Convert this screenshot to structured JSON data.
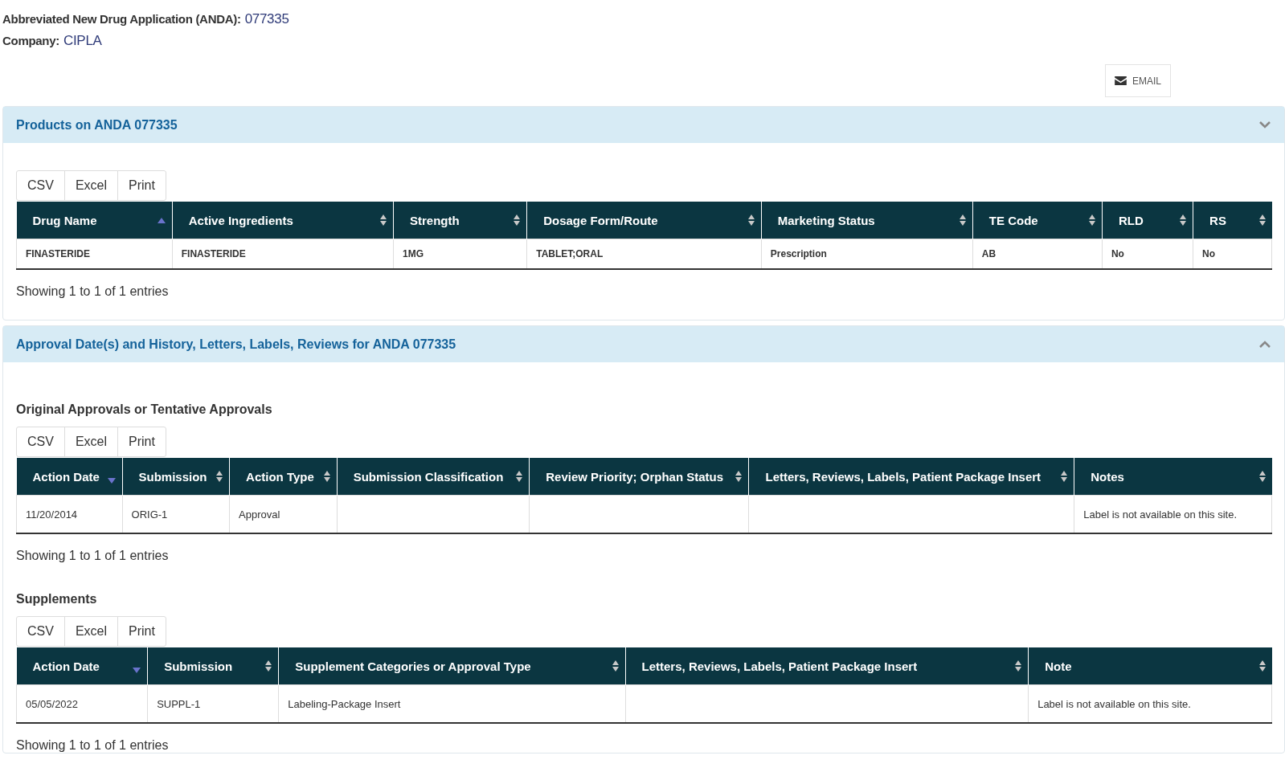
{
  "application": {
    "label": "Abbreviated New Drug Application (ANDA):",
    "value": "077335"
  },
  "company": {
    "label": "Company:",
    "value": "CIPLA"
  },
  "email_button": {
    "label": "EMAIL"
  },
  "panels": [
    {
      "title": "Products on ANDA 077335",
      "chevron_up": false,
      "sections": [
        {
          "buttons": [
            "CSV",
            "Excel",
            "Print"
          ],
          "bold_cells": true,
          "info": "Showing 1 to 1 of 1 entries",
          "columns": [
            {
              "label": "Drug Name",
              "sorted": true,
              "descending": false
            },
            {
              "label": "Active Ingredients",
              "sorted": false,
              "descending": false
            },
            {
              "label": "Strength",
              "sorted": false,
              "descending": false
            },
            {
              "label": "Dosage Form/Route",
              "sorted": false,
              "descending": false
            },
            {
              "label": "Marketing Status",
              "sorted": false,
              "descending": false
            },
            {
              "label": "TE Code",
              "sorted": false,
              "descending": false
            },
            {
              "label": "RLD",
              "sorted": false,
              "descending": false
            },
            {
              "label": "RS",
              "sorted": false,
              "descending": false
            }
          ],
          "rows": [
            [
              "FINASTERIDE",
              "FINASTERIDE",
              "1MG",
              "TABLET;ORAL",
              "Prescription",
              "AB",
              "No",
              "No"
            ]
          ]
        }
      ]
    },
    {
      "title": "Approval Date(s) and History, Letters, Labels, Reviews for ANDA 077335",
      "chevron_up": true,
      "sections": [
        {
          "heading": "Original Approvals or Tentative Approvals",
          "buttons": [
            "CSV",
            "Excel",
            "Print"
          ],
          "bold_cells": false,
          "info": "Showing 1 to 1 of 1 entries",
          "columns": [
            {
              "label": "Action Date",
              "sorted": true,
              "descending": true
            },
            {
              "label": "Submission",
              "sorted": false,
              "descending": false
            },
            {
              "label": "Action Type",
              "sorted": false,
              "descending": false
            },
            {
              "label": "Submission Classification",
              "sorted": false,
              "descending": false
            },
            {
              "label": "Review Priority; Orphan Status",
              "sorted": false,
              "descending": false
            },
            {
              "label": "Letters, Reviews, Labels, Patient Package Insert",
              "sorted": false,
              "descending": false
            },
            {
              "label": "Notes",
              "sorted": false,
              "descending": false
            }
          ],
          "rows": [
            [
              "11/20/2014",
              "ORIG-1",
              "Approval",
              "",
              "",
              "",
              "Label is not available on this site."
            ]
          ]
        },
        {
          "heading": "Supplements",
          "buttons": [
            "CSV",
            "Excel",
            "Print"
          ],
          "bold_cells": false,
          "info": "Showing 1 to 1 of 1 entries",
          "columns": [
            {
              "label": "Action Date",
              "sorted": true,
              "descending": true
            },
            {
              "label": "Submission",
              "sorted": false,
              "descending": false
            },
            {
              "label": "Supplement Categories or Approval Type",
              "sorted": false,
              "descending": false
            },
            {
              "label": "Letters, Reviews, Labels, Patient Package Insert",
              "sorted": false,
              "descending": false
            },
            {
              "label": "Note",
              "sorted": false,
              "descending": false
            }
          ],
          "rows": [
            [
              "05/05/2022",
              "SUPPL-1",
              "Labeling-Package Insert",
              "",
              "Label is not available on this site."
            ]
          ]
        }
      ]
    }
  ]
}
